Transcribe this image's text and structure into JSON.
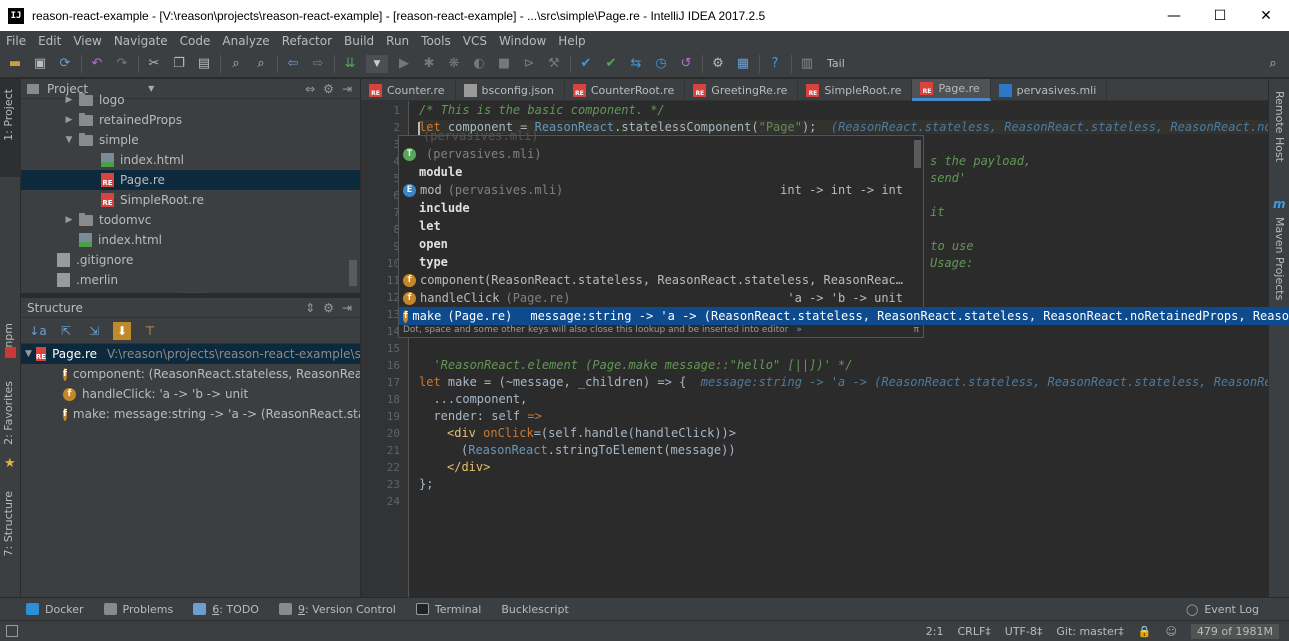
{
  "window": {
    "title": "reason-react-example - [V:\\reason\\projects\\reason-react-example] - [reason-react-example] - ...\\src\\simple\\Page.re - IntelliJ IDEA 2017.2.5",
    "app_icon": "IJ",
    "minimize": "—",
    "maximize": "☐",
    "close": "✕"
  },
  "menu": [
    "File",
    "Edit",
    "View",
    "Navigate",
    "Code",
    "Analyze",
    "Refactor",
    "Build",
    "Run",
    "Tools",
    "VCS",
    "Window",
    "Help"
  ],
  "toolbar": {
    "tail_label": "Tail"
  },
  "left_strip": {
    "project": "1: Project",
    "npm": "npm",
    "favorites": "2: Favorites",
    "structure": "7: Structure"
  },
  "right_strip": {
    "remote_host": "Remote Host",
    "maven": "Maven Projects"
  },
  "project_panel": {
    "title": "Project",
    "tree": [
      {
        "label": "logo",
        "kind": "folder",
        "depth": 1,
        "expanded": false
      },
      {
        "label": "retainedProps",
        "kind": "folder",
        "depth": 1,
        "expanded": false
      },
      {
        "label": "simple",
        "kind": "folder",
        "depth": 1,
        "expanded": true
      },
      {
        "label": "index.html",
        "kind": "html",
        "depth": 2
      },
      {
        "label": "Page.re",
        "kind": "re",
        "depth": 2,
        "selected": true
      },
      {
        "label": "SimpleRoot.re",
        "kind": "re",
        "depth": 2
      },
      {
        "label": "todomvc",
        "kind": "folder",
        "depth": 1,
        "expanded": false
      },
      {
        "label": "index.html",
        "kind": "html",
        "depth": 1
      },
      {
        "label": ".gitignore",
        "kind": "txt",
        "depth": 0
      },
      {
        "label": ".merlin",
        "kind": "txt",
        "depth": 0
      }
    ]
  },
  "structure_panel": {
    "title": "Structure",
    "root_label": "Page.re",
    "root_path": "V:\\reason\\projects\\reason-react-example\\s",
    "items": [
      "component: (ReasonReact.stateless, ReasonReact",
      "handleClick: 'a -> 'b -> unit",
      "make: message:string -> 'a -> (ReasonReact.sta"
    ]
  },
  "editor_tabs": [
    {
      "label": "Counter.re",
      "icon": "re"
    },
    {
      "label": "bsconfig.json",
      "icon": "json"
    },
    {
      "label": "CounterRoot.re",
      "icon": "re"
    },
    {
      "label": "GreetingRe.re",
      "icon": "re"
    },
    {
      "label": "SimpleRoot.re",
      "icon": "re"
    },
    {
      "label": "Page.re",
      "icon": "re",
      "active": true
    },
    {
      "label": "pervasives.mli",
      "icon": "ml"
    }
  ],
  "line_numbers": [
    "1",
    "2",
    "3",
    "4",
    "5",
    "6",
    "7",
    "8",
    "9",
    "10",
    "11",
    "12",
    "13",
    "14",
    "15",
    "16",
    "17",
    "18",
    "19",
    "20",
    "21",
    "22",
    "23",
    "24"
  ],
  "code": {
    "l1": "/* This is the basic component. */",
    "l2_kw": "let",
    "l2_a": " component = ",
    "l2_mod": "ReasonReact",
    "l2_b": ".statelessComponent(",
    "l2_str": "\"Page\"",
    "l2_c": ");",
    "l2_hint": "  (ReasonReact.stateless, ReasonReact.stateless, ReasonReact.noRe",
    "l4_frag": "s the payload,",
    "l5_frag": "send'",
    "l7_frag": "it",
    "l9_frag": " to use",
    "l10_frag": "Usage:",
    "l16": "  'ReasonReact.element (Page.make message::\"hello\" [||])' */",
    "l17_kw": "let",
    "l17_a": " make = (~message, _children) => {",
    "l17_hint": "  message:string -> 'a -> (ReasonReact.stateless, ReasonReact.stateless, ReasonReact",
    "l18": "  ...component,",
    "l19_a": "  render: self ",
    "l19_arrow": "=>",
    "l20_tag_open": "<div ",
    "l20_attr": "onClick",
    "l20_rest": "=(self.handle(handleClick))>",
    "l21_mod": "ReasonReact",
    "l21_rest": ".stringToElement(message))",
    "l21_open": "(",
    "l22": "</div>",
    "l23": "};"
  },
  "completion": {
    "items": [
      {
        "badge": "T",
        "name": "(pervasives.mli)",
        "dim": true
      },
      {
        "badge": "",
        "name": "module",
        "keyword": true
      },
      {
        "badge": "E",
        "name": "mod",
        "dim_text": "(pervasives.mli)",
        "type": "int -> int -> int"
      },
      {
        "badge": "",
        "name": "include",
        "keyword": true
      },
      {
        "badge": "",
        "name": "let",
        "keyword": true
      },
      {
        "badge": "",
        "name": "open",
        "keyword": true
      },
      {
        "badge": "",
        "name": "type",
        "keyword": true
      },
      {
        "badge": "f",
        "name": "component",
        "type": "(ReasonReact.stateless, ReasonReact.stateless, ReasonReac…"
      },
      {
        "badge": "f",
        "name": "handleClick",
        "dim_text": "(Page.re)",
        "type": "'a -> 'b -> unit"
      },
      {
        "badge": "f",
        "name": "make",
        "dim_text": "(Page.re)",
        "type": "message:string -> 'a -> (ReasonReact.stateless, ReasonReact.stateless, ReasonReact.noRetainedProps, ReasonRe",
        "selected": true
      }
    ],
    "ghost_top": "(pervasives.mli)",
    "footer": "Dot, space and some other keys will also close this lookup and be inserted into editor",
    "footer_link": "»",
    "footer_pi": "π"
  },
  "bottom_tools": [
    {
      "label": "Docker",
      "num": ""
    },
    {
      "label": "Problems",
      "num": ""
    },
    {
      "label": ": TODO",
      "num": "6"
    },
    {
      "label": ": Version Control",
      "num": "9"
    },
    {
      "label": "Terminal",
      "num": ""
    },
    {
      "label": "Bucklescript",
      "num": ""
    }
  ],
  "event_log": "Event Log",
  "status": {
    "position": "2:1",
    "line_sep": "CRLF‡",
    "encoding": "UTF-8‡",
    "vcs": "Git: master‡",
    "memory": "479 of 1981M"
  },
  "colors": {
    "selection": "#0d4b8e",
    "re_icon": "#d9423d",
    "accent": "#4a88c7"
  }
}
